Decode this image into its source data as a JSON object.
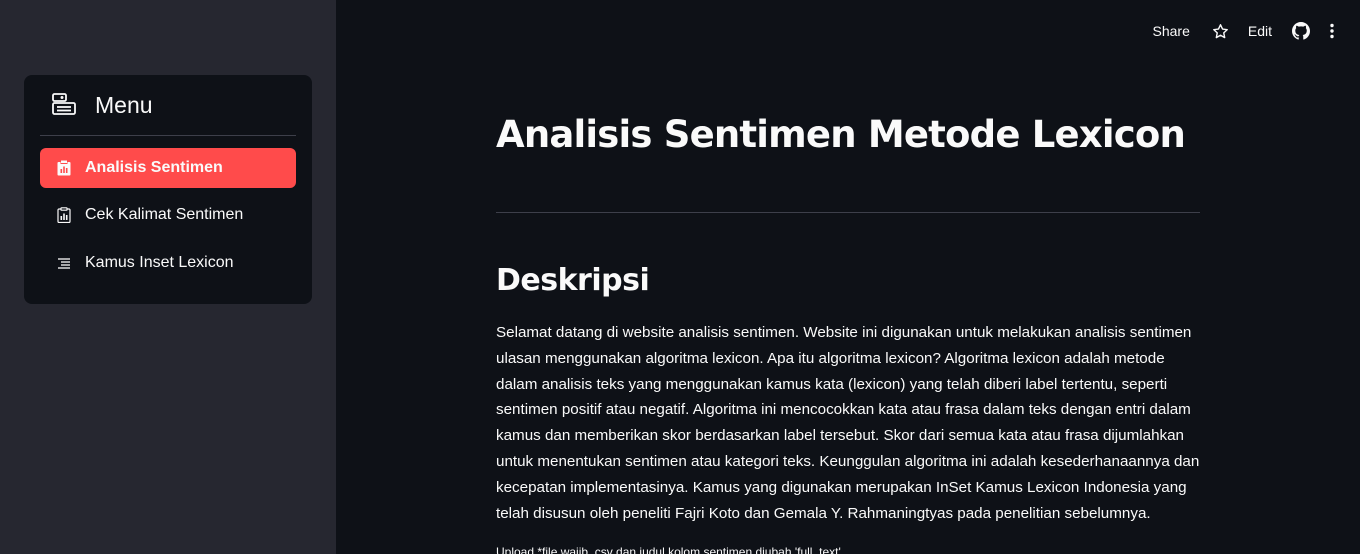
{
  "sidebar": {
    "menu_title": "Menu",
    "items": [
      {
        "label": "Analisis Sentimen",
        "icon": "clipboard-data-icon",
        "active": true
      },
      {
        "label": "Cek Kalimat Sentimen",
        "icon": "clipboard-data-icon",
        "active": false
      },
      {
        "label": "Kamus Inset Lexicon",
        "icon": "list-icon",
        "active": false
      }
    ]
  },
  "toolbar": {
    "share_label": "Share",
    "edit_label": "Edit",
    "icons": [
      "star-icon",
      "github-icon",
      "more-vertical-icon"
    ]
  },
  "main": {
    "title": "Analisis Sentimen Metode Lexicon",
    "section_title": "Deskripsi",
    "description": "Selamat datang di website analisis sentimen. Website ini digunakan untuk melakukan analisis sentimen ulasan menggunakan algoritma lexicon. Apa itu algoritma lexicon? Algoritma lexicon adalah metode dalam analisis teks yang menggunakan kamus kata (lexicon) yang telah diberi label tertentu, seperti sentimen positif atau negatif. Algoritma ini mencocokkan kata atau frasa dalam teks dengan entri dalam kamus dan memberikan skor berdasarkan label tersebut. Skor dari semua kata atau frasa dijumlahkan untuk menentukan sentimen atau kategori teks. Keunggulan algoritma ini adalah kesederhanaannya dan kecepatan implementasinya. Kamus yang digunakan merupakan InSet Kamus Lexicon Indonesia yang telah disusun oleh peneliti Fajri Koto dan Gemala Y. Rahmaningtyas pada penelitian sebelumnya.",
    "upload_note": "Upload *file wajib .csv dan judul kolom sentimen diubah 'full_text'"
  },
  "colors": {
    "accent": "#ff4b4b",
    "sidebar_bg": "#262730",
    "main_bg": "#0e1117"
  }
}
